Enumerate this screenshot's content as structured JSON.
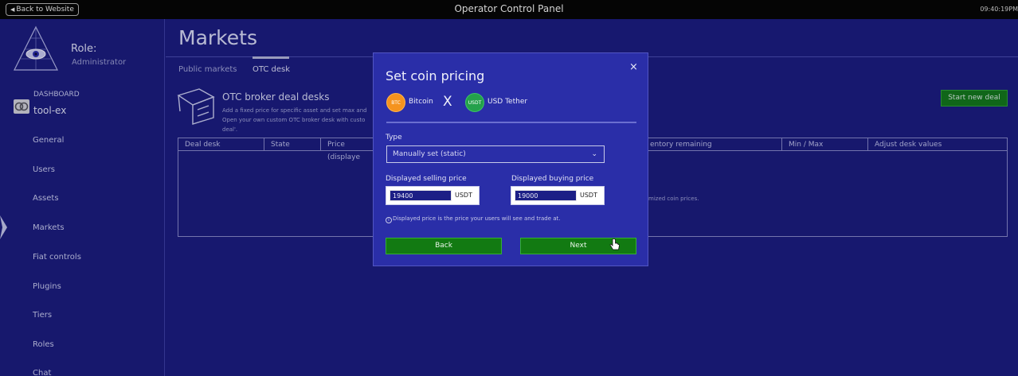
{
  "topbar": {
    "back_label": "Back to Website",
    "title": "Operator Control Panel",
    "time": "09:40:19PM"
  },
  "sidebar": {
    "role_label": "Role:",
    "role_value": "Administrator",
    "dashboard_label": "DASHBOARD",
    "dashboard_name": "tool-ex",
    "items": [
      {
        "label": "General"
      },
      {
        "label": "Users"
      },
      {
        "label": "Assets"
      },
      {
        "label": "Markets",
        "active": true
      },
      {
        "label": "Fiat controls"
      },
      {
        "label": "Plugins"
      },
      {
        "label": "Tiers"
      },
      {
        "label": "Roles"
      },
      {
        "label": "Chat"
      }
    ]
  },
  "main": {
    "title": "Markets",
    "tabs": [
      {
        "label": "Public markets"
      },
      {
        "label": "OTC desk",
        "active": true
      }
    ],
    "otc": {
      "title": "OTC broker deal desks",
      "desc_line1": "Add a fixed price for specific asset and set max and",
      "desc_line2": "Open your own custom OTC broker desk with custo",
      "desc_line3": "deal'.",
      "start_button": "Start new deal"
    },
    "table": {
      "headers": [
        "Deal desk",
        "State",
        "Price (displaye",
        "",
        "entory remaining",
        "Min / Max",
        "Adjust desk values"
      ],
      "empty_message": "mized coin prices."
    }
  },
  "modal": {
    "title": "Set coin pricing",
    "close_glyph": "×",
    "base_coin": {
      "symbol": "BTC",
      "name": "Bitcoin",
      "color": "#f5931e"
    },
    "pair_separator": "X",
    "quote_coin": {
      "symbol": "USDT",
      "name": "USD Tether",
      "color": "#24a14b"
    },
    "type_label": "Type",
    "type_value": "Manually set (static)",
    "selling_label": "Displayed selling price",
    "selling_value": "19400",
    "selling_unit": "USDT",
    "buying_label": "Displayed buying price",
    "buying_value": "19000",
    "buying_unit": "USDT",
    "info_note": "Displayed price is the price your users will see and trade at.",
    "back_button": "Back",
    "next_button": "Next"
  },
  "colors": {
    "background": "#1a1c7a",
    "modal": "#2a2ea8",
    "button_green": "#127a12"
  }
}
